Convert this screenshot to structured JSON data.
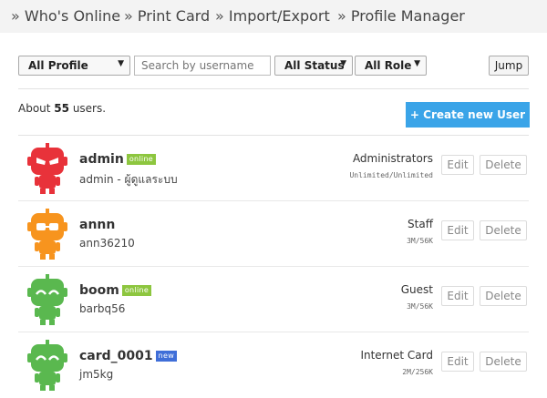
{
  "nav": {
    "separator": "»",
    "items": [
      "Who's Online",
      "Print Card",
      "Import/Export",
      "Profile Manager"
    ]
  },
  "filters": {
    "profile": "All Profile",
    "search_placeholder": "Search by username",
    "status": "All Status",
    "role": "All Role",
    "jump_label": "Jump"
  },
  "summary": {
    "prefix": "About ",
    "count": "55",
    "suffix": " users."
  },
  "create_button": "+ Create new User",
  "row_buttons": {
    "edit": "Edit",
    "delete": "Delete"
  },
  "colors": {
    "red": "#e8323a",
    "orange": "#f7941e",
    "green": "#5ab84f",
    "button": "#3aa4e8",
    "online": "#8dc63f",
    "new": "#3f6ed8"
  },
  "users": [
    {
      "name": "admin",
      "badge": "online",
      "sub": "admin - ผู้ดูแลระบบ",
      "role": "Administrators",
      "quota": "Unlimited/Unlimited",
      "avatar": "red"
    },
    {
      "name": "annn",
      "badge": "",
      "sub": "ann36210",
      "role": "Staff",
      "quota": "3M/56K",
      "avatar": "orange"
    },
    {
      "name": "boom",
      "badge": "online",
      "sub": "barbq56",
      "role": "Guest",
      "quota": "3M/56K",
      "avatar": "green"
    },
    {
      "name": "card_0001",
      "badge": "new",
      "sub": "jm5kg",
      "role": "Internet Card",
      "quota": "2M/256K",
      "avatar": "green"
    }
  ]
}
